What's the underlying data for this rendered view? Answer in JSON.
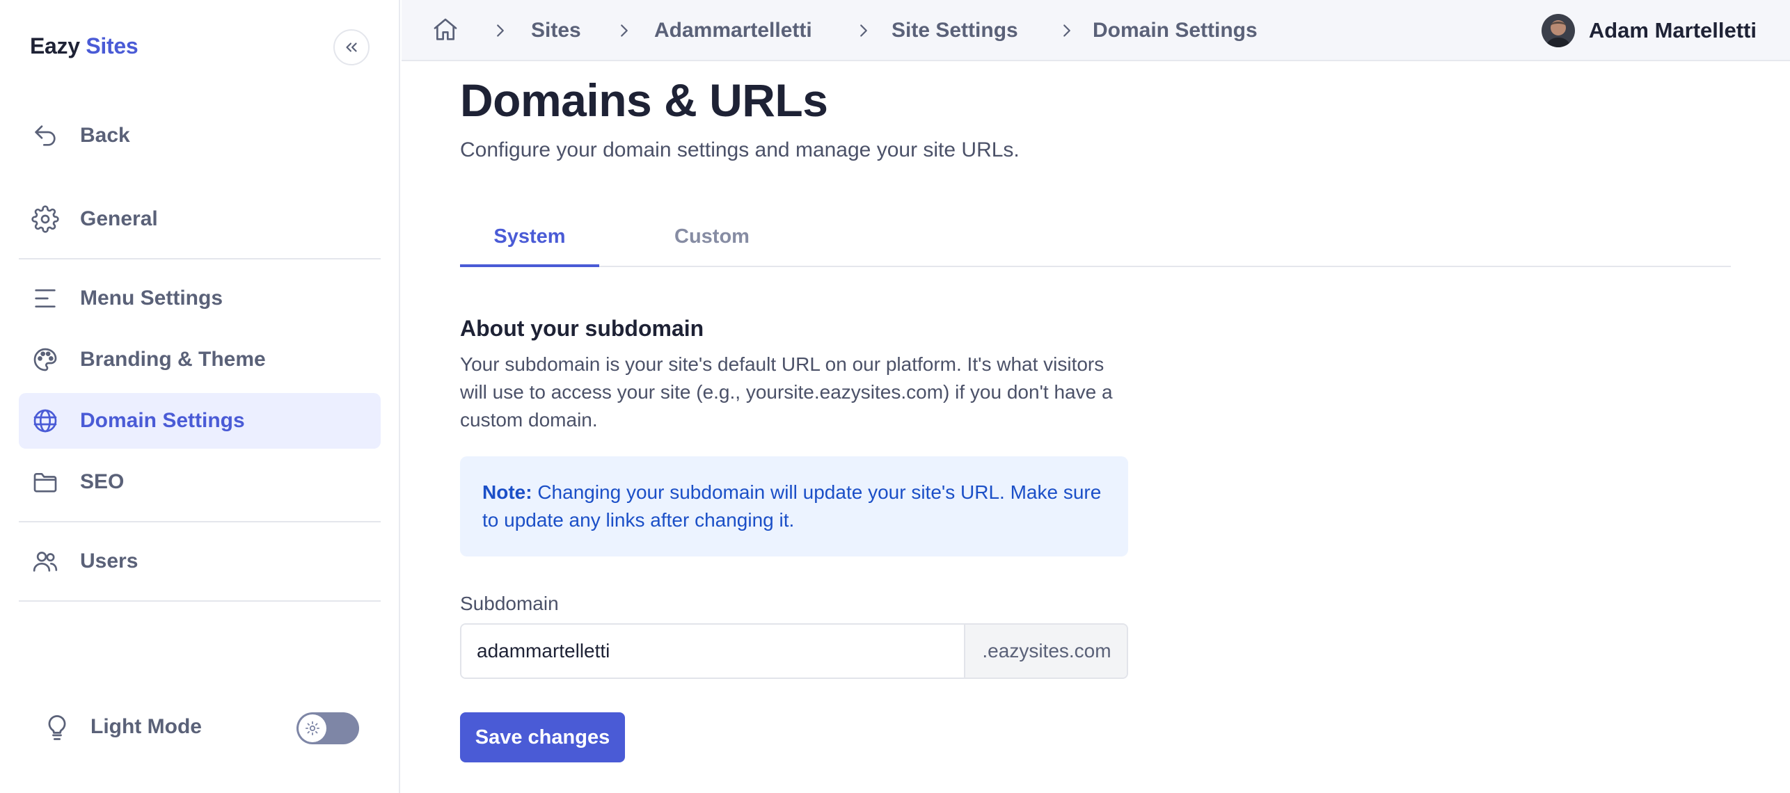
{
  "brand": {
    "part1": "Eazy",
    "part2": "Sites"
  },
  "sidebar": {
    "items": [
      {
        "label": "Back",
        "icon": "back-arrow-icon"
      },
      {
        "label": "General",
        "icon": "gear-icon"
      },
      {
        "label": "Menu Settings",
        "icon": "menu-lines-icon"
      },
      {
        "label": "Branding & Theme",
        "icon": "palette-icon"
      },
      {
        "label": "Domain Settings",
        "icon": "globe-icon",
        "active": true
      },
      {
        "label": "SEO",
        "icon": "folder-icon"
      },
      {
        "label": "Users",
        "icon": "users-icon"
      }
    ],
    "light_mode": {
      "label": "Light Mode",
      "icon": "lightbulb-icon",
      "enabled": true
    }
  },
  "breadcrumb": [
    "Sites",
    "Adammartelletti",
    "Site Settings",
    "Domain Settings"
  ],
  "user": {
    "name": "Adam Martelletti"
  },
  "main": {
    "title": "Domains & URLs",
    "subtitle": "Configure your domain settings and manage your site URLs.",
    "tabs": [
      {
        "label": "System",
        "active": true
      },
      {
        "label": "Custom",
        "active": false
      }
    ],
    "section": {
      "title": "About your subdomain",
      "description": "Your subdomain is your site's default URL on our platform. It's what visitors will use to access your site (e.g., yoursite.eazysites.com) if you don't have a custom domain."
    },
    "note": {
      "label": "Note:",
      "text": "Changing your subdomain will update your site's URL. Make sure to update any links after changing it."
    },
    "subdomain": {
      "label": "Subdomain",
      "value": "adammartelletti",
      "suffix": ".eazysites.com"
    },
    "save_label": "Save changes"
  },
  "colors": {
    "accent": "#4a5bd6",
    "active_bg": "#ecefff",
    "note_bg": "#ecf3ff",
    "note_text": "#1b4fc7"
  }
}
